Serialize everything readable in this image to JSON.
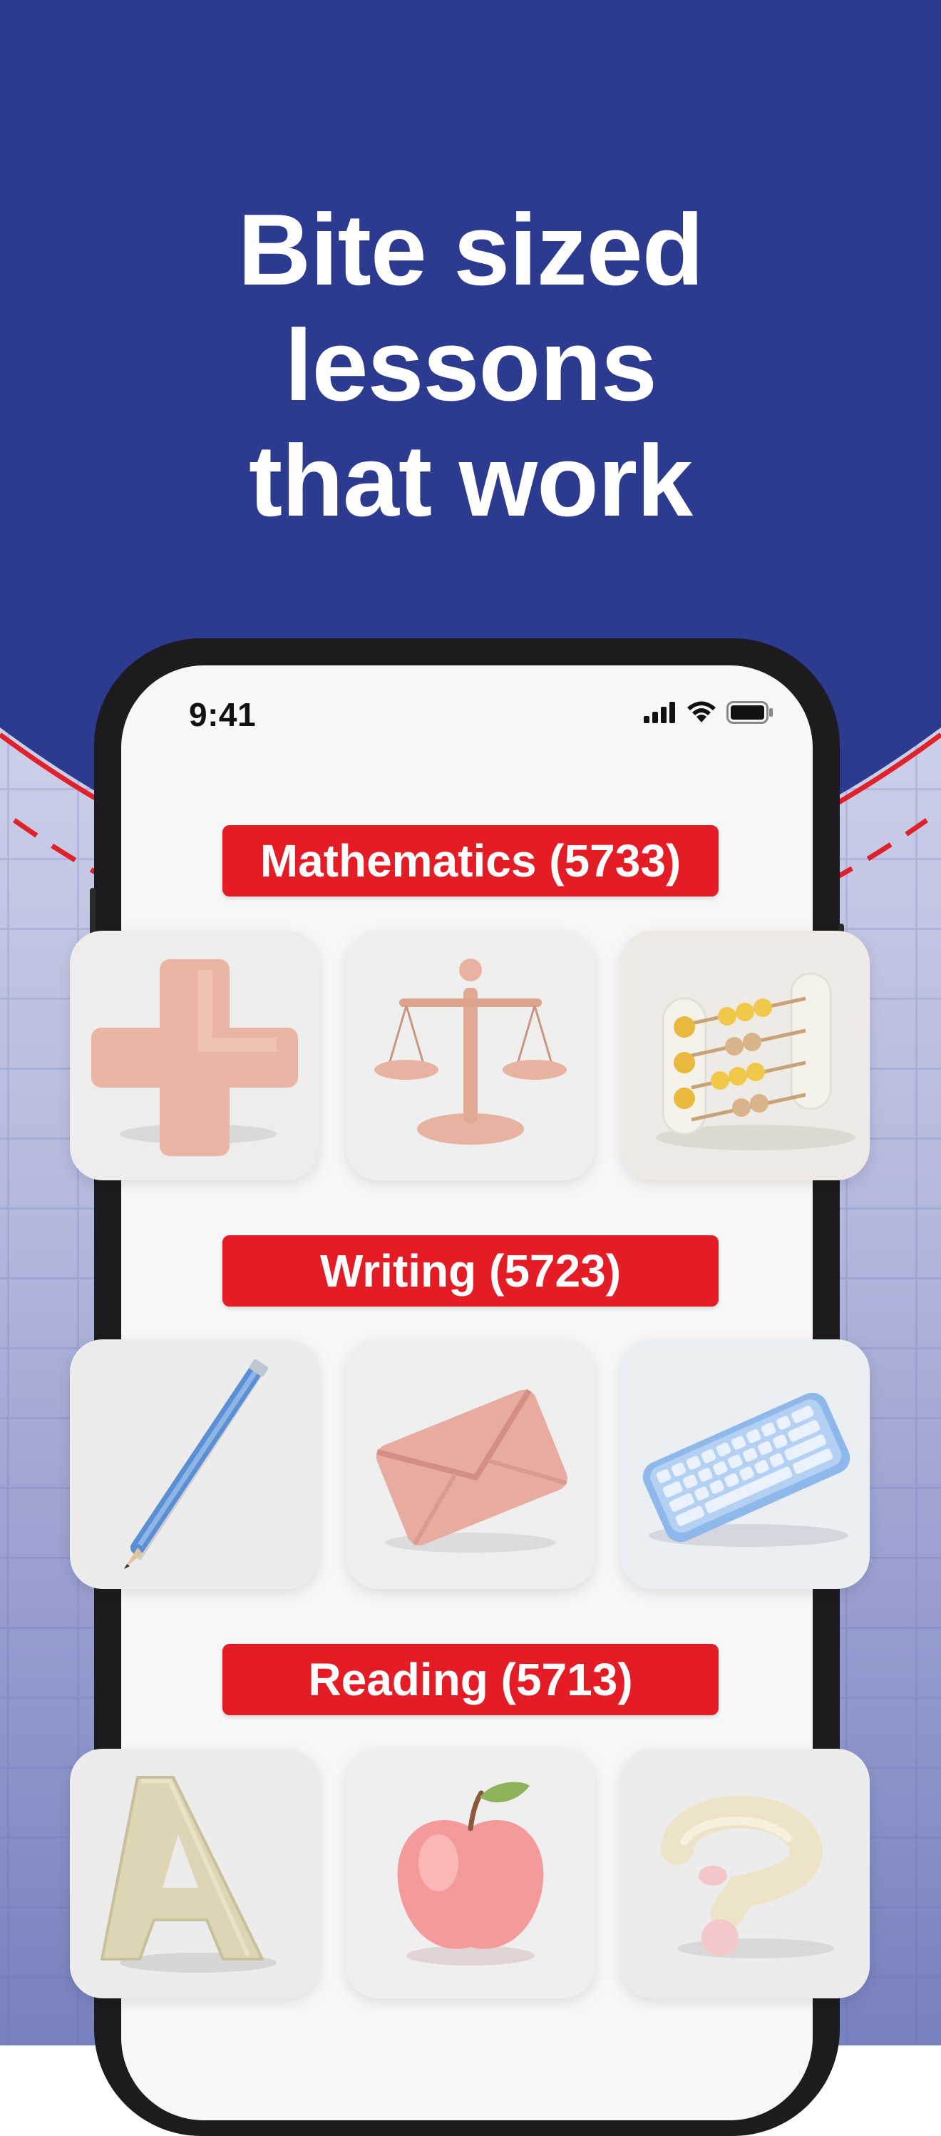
{
  "headline": {
    "line1": "Bite sized",
    "line2": "lessons",
    "line3": "that work"
  },
  "status_bar": {
    "time": "9:41",
    "icons": [
      "signal-icon",
      "wifi-icon",
      "battery-icon"
    ]
  },
  "categories": [
    {
      "label": "Mathematics (5733)",
      "items": [
        "plus-sign-icon",
        "balance-scale-icon",
        "abacus-icon"
      ]
    },
    {
      "label": "Writing (5723)",
      "items": [
        "pencil-icon",
        "envelope-icon",
        "keyboard-icon"
      ]
    },
    {
      "label": "Reading (5713)",
      "items": [
        "letter-a-icon",
        "apple-icon",
        "question-mark-icon"
      ]
    }
  ],
  "colors": {
    "header_blue": "#2c3a8f",
    "label_red": "#e41c26",
    "accent_red": "#e0202a",
    "screen_bg": "#f7f7f7",
    "phone_frame": "#1c1c1e"
  }
}
